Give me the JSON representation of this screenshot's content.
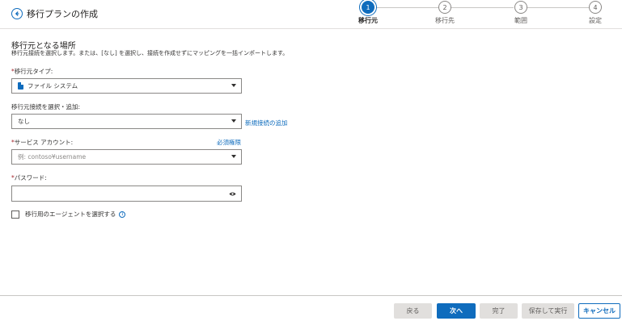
{
  "header": {
    "title": "移行プランの作成"
  },
  "stepper": {
    "steps": [
      {
        "number": "1",
        "label": "移行元"
      },
      {
        "number": "2",
        "label": "移行先"
      },
      {
        "number": "3",
        "label": "範囲"
      },
      {
        "number": "4",
        "label": "設定"
      }
    ],
    "active_index": 0
  },
  "form": {
    "section_title": "移行元となる場所",
    "section_desc": "移行元接続を選択します。または、[なし] を選択し、接続を作成せずにマッピングを一括インポートします。",
    "source_type": {
      "label": "移行元タイプ:",
      "value": "ファイル システム"
    },
    "connection": {
      "label": "移行元接続を選択・追加:",
      "value": "なし",
      "add_link": "新規接続の追加"
    },
    "service_account": {
      "label": "サービス アカウント:",
      "placeholder": "例: contoso¥username",
      "link": "必須権限"
    },
    "password": {
      "label": "パスワード:"
    },
    "agent_checkbox": {
      "label": "移行用のエージェントを選択する"
    }
  },
  "footer": {
    "back": "戻る",
    "next": "次へ",
    "done": "完了",
    "save_run": "保存して実行",
    "cancel": "キャンセル"
  },
  "colors": {
    "accent": "#0f6cbd",
    "required": "#a4262c",
    "disabled": "#e1dfdd"
  }
}
